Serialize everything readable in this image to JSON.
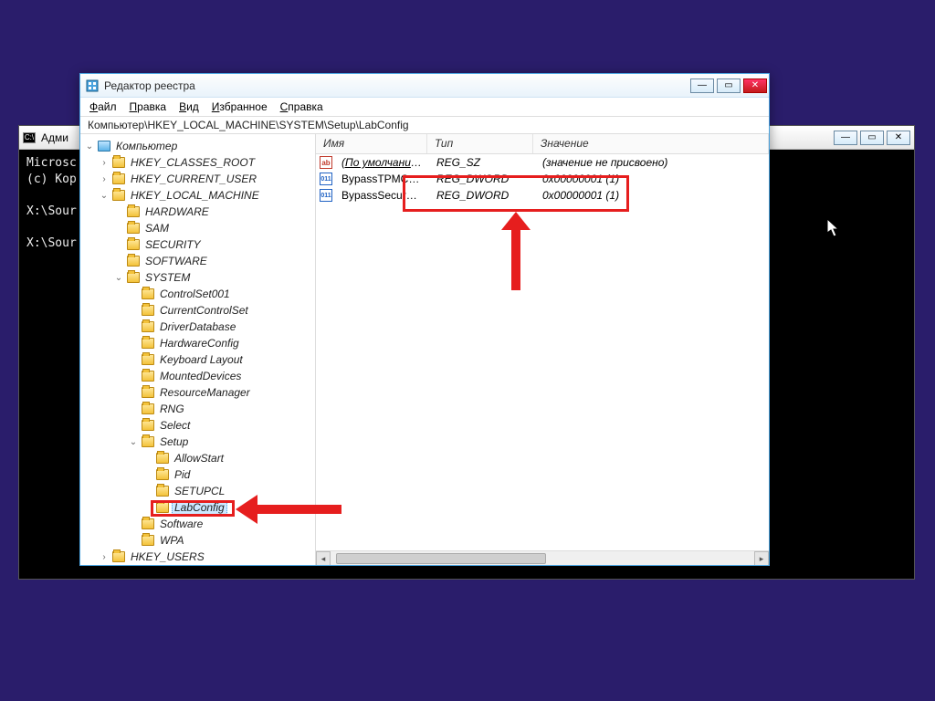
{
  "cmd": {
    "title": "Адми",
    "lines": [
      "Microsc",
      "(c) Кор",
      "",
      "X:\\Sour",
      "",
      "X:\\Sour"
    ]
  },
  "regedit": {
    "title": "Редактор реестра",
    "menu": [
      "Файл",
      "Правка",
      "Вид",
      "Избранное",
      "Справка"
    ],
    "address": "Компьютер\\HKEY_LOCAL_MACHINE\\SYSTEM\\Setup\\LabConfig",
    "columns": {
      "name": "Имя",
      "type": "Тип",
      "value": "Значение"
    },
    "rows": [
      {
        "icon": "str",
        "name": "(По умолчанию)",
        "type": "REG_SZ",
        "value": "(значение не присвоено)",
        "default": true
      },
      {
        "icon": "dw",
        "name": "BypassTPMCheck",
        "type": "REG_DWORD",
        "value": "0x00000001 (1)"
      },
      {
        "icon": "dw",
        "name": "BypassSecureBo...",
        "type": "REG_DWORD",
        "value": "0x00000001 (1)"
      }
    ],
    "tree": {
      "root": "Компьютер",
      "hives": [
        {
          "label": "HKEY_CLASSES_ROOT",
          "open": false
        },
        {
          "label": "HKEY_CURRENT_USER",
          "open": false
        },
        {
          "label": "HKEY_LOCAL_MACHINE",
          "open": true,
          "children": [
            {
              "label": "HARDWARE"
            },
            {
              "label": "SAM"
            },
            {
              "label": "SECURITY"
            },
            {
              "label": "SOFTWARE"
            },
            {
              "label": "SYSTEM",
              "open": true,
              "children": [
                {
                  "label": "ControlSet001"
                },
                {
                  "label": "CurrentControlSet"
                },
                {
                  "label": "DriverDatabase"
                },
                {
                  "label": "HardwareConfig"
                },
                {
                  "label": "Keyboard Layout"
                },
                {
                  "label": "MountedDevices"
                },
                {
                  "label": "ResourceManager"
                },
                {
                  "label": "RNG"
                },
                {
                  "label": "Select"
                },
                {
                  "label": "Setup",
                  "open": true,
                  "children": [
                    {
                      "label": "AllowStart"
                    },
                    {
                      "label": "Pid"
                    },
                    {
                      "label": "SETUPCL"
                    },
                    {
                      "label": "LabConfig",
                      "selected": true
                    }
                  ]
                },
                {
                  "label": "Software"
                },
                {
                  "label": "WPA"
                }
              ]
            }
          ]
        },
        {
          "label": "HKEY_USERS",
          "open": false
        }
      ]
    }
  }
}
